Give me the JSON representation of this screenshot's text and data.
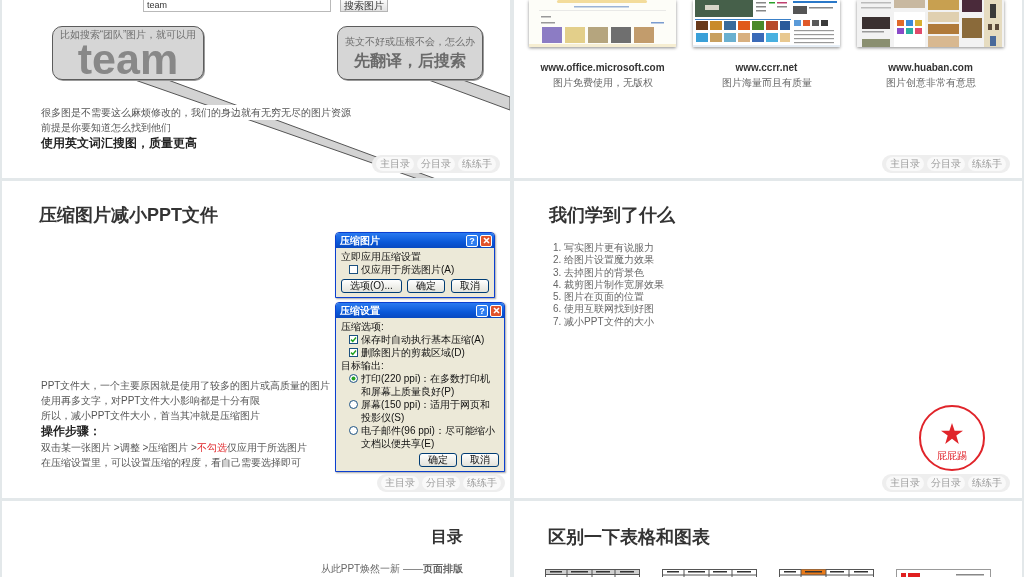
{
  "slides": [
    {
      "kind": "search_tips",
      "search": {
        "value": "team",
        "button": "搜索图片"
      },
      "callouts": [
        {
          "caption": "比如搜索“团队”图片，就可以用",
          "headline": "team"
        },
        {
          "caption": "英文不好或压根不会，怎么办",
          "headline": "先翻译，后搜索"
        }
      ],
      "paragraphs": [
        {
          "kind": "text",
          "text": "很多图是不需要这么麻烦修改的，我们的身边就有无穷无尽的图片资源"
        },
        {
          "kind": "text",
          "text": "前提是你要知道怎么找到他们"
        },
        {
          "kind": "heading",
          "text": "使用英文词汇搜图，质量更高"
        }
      ],
      "nav": [
        "主目录",
        "分目录",
        "练练手"
      ]
    },
    {
      "kind": "websites",
      "sites": [
        {
          "url": "www.office.microsoft.com",
          "note": "图片免费使用，无版权"
        },
        {
          "url": "www.ccrr.net",
          "note": "图片海量而且有质量"
        },
        {
          "url": "www.huaban.com",
          "note": "图片创意非常有意思"
        }
      ],
      "nav": [
        "主目录",
        "分目录",
        "练练手"
      ]
    },
    {
      "kind": "compress",
      "title": "压缩图片减小PPT文件",
      "dialogs": [
        {
          "title": "压缩图片",
          "help": "?",
          "sections": [
            {
              "label": "立即应用压缩设置",
              "options": [
                {
                  "kind": "checkbox",
                  "label": "仅应用于所选图片(A)",
                  "checked": false
                }
              ]
            }
          ],
          "buttons": [
            "选项(O)...",
            "确定",
            "取消"
          ]
        },
        {
          "title": "压缩设置",
          "help": "?",
          "sections": [
            {
              "label": "压缩选项:",
              "options": [
                {
                  "kind": "checkbox",
                  "label": "保存时自动执行基本压缩(A)",
                  "checked": true
                },
                {
                  "kind": "checkbox",
                  "label": "删除图片的剪裁区域(D)",
                  "checked": true
                }
              ]
            },
            {
              "label": "目标输出:",
              "options": [
                {
                  "kind": "radio",
                  "label": "打印(220 ppi)：在多数打印机和屏幕上质量良好(P)",
                  "selected": true
                },
                {
                  "kind": "radio",
                  "label": "屏幕(150 ppi)：适用于网页和投影仪(S)",
                  "selected": false
                },
                {
                  "kind": "radio",
                  "label": "电子邮件(96 ppi)：尽可能缩小文档以便共享(E)",
                  "selected": false
                }
              ]
            }
          ],
          "buttons": [
            "确定",
            "取消"
          ]
        }
      ],
      "paragraphs": [
        {
          "kind": "text",
          "segments": [
            {
              "text": "PPT文件大，一个主要原因就是使用了较多的图片或高质量的图片",
              "highlight": false
            }
          ]
        },
        {
          "kind": "text",
          "segments": [
            {
              "text": "使用再多文字，对PPT文件大小影响都是十分有限",
              "highlight": false
            }
          ]
        },
        {
          "kind": "text",
          "segments": [
            {
              "text": "所以，减小PPT文件大小，首当其冲就是压缩图片",
              "highlight": false
            }
          ]
        },
        {
          "kind": "heading",
          "segments": [
            {
              "text": "操作步骤：",
              "highlight": false
            }
          ]
        },
        {
          "kind": "text",
          "segments": [
            {
              "text": "双击某一张图片 >调整 >压缩图片 >",
              "highlight": false
            },
            {
              "text": "不勾选",
              "highlight": true
            },
            {
              "text": "仅应用于所选图片",
              "highlight": false
            }
          ]
        },
        {
          "kind": "text",
          "segments": [
            {
              "text": "在压缩设置里，可以设置压缩的程度，看自己需要选择即可",
              "highlight": false
            }
          ]
        }
      ],
      "nav": [
        "主目录",
        "分目录",
        "练练手"
      ]
    },
    {
      "kind": "summary",
      "title": "我们学到了什么",
      "items": [
        "1. 写实图片更有说服力",
        "2. 给图片设置魔力效果",
        "3. 去掉图片的背景色",
        "4. 裁剪图片制作宽屏效果",
        "5. 图片在页面的位置",
        "6. 使用互联网找到好图",
        "7. 减小PPT文件的大小"
      ],
      "stamp": {
        "text": "屁屁踢"
      },
      "nav": [
        "主目录",
        "分目录",
        "练练手"
      ]
    },
    {
      "kind": "contents",
      "title": "目录",
      "subtitle": "从此PPT焕然一新 ——**页面排版**"
    },
    {
      "kind": "tables",
      "title": "区别一下表格和图表"
    }
  ]
}
